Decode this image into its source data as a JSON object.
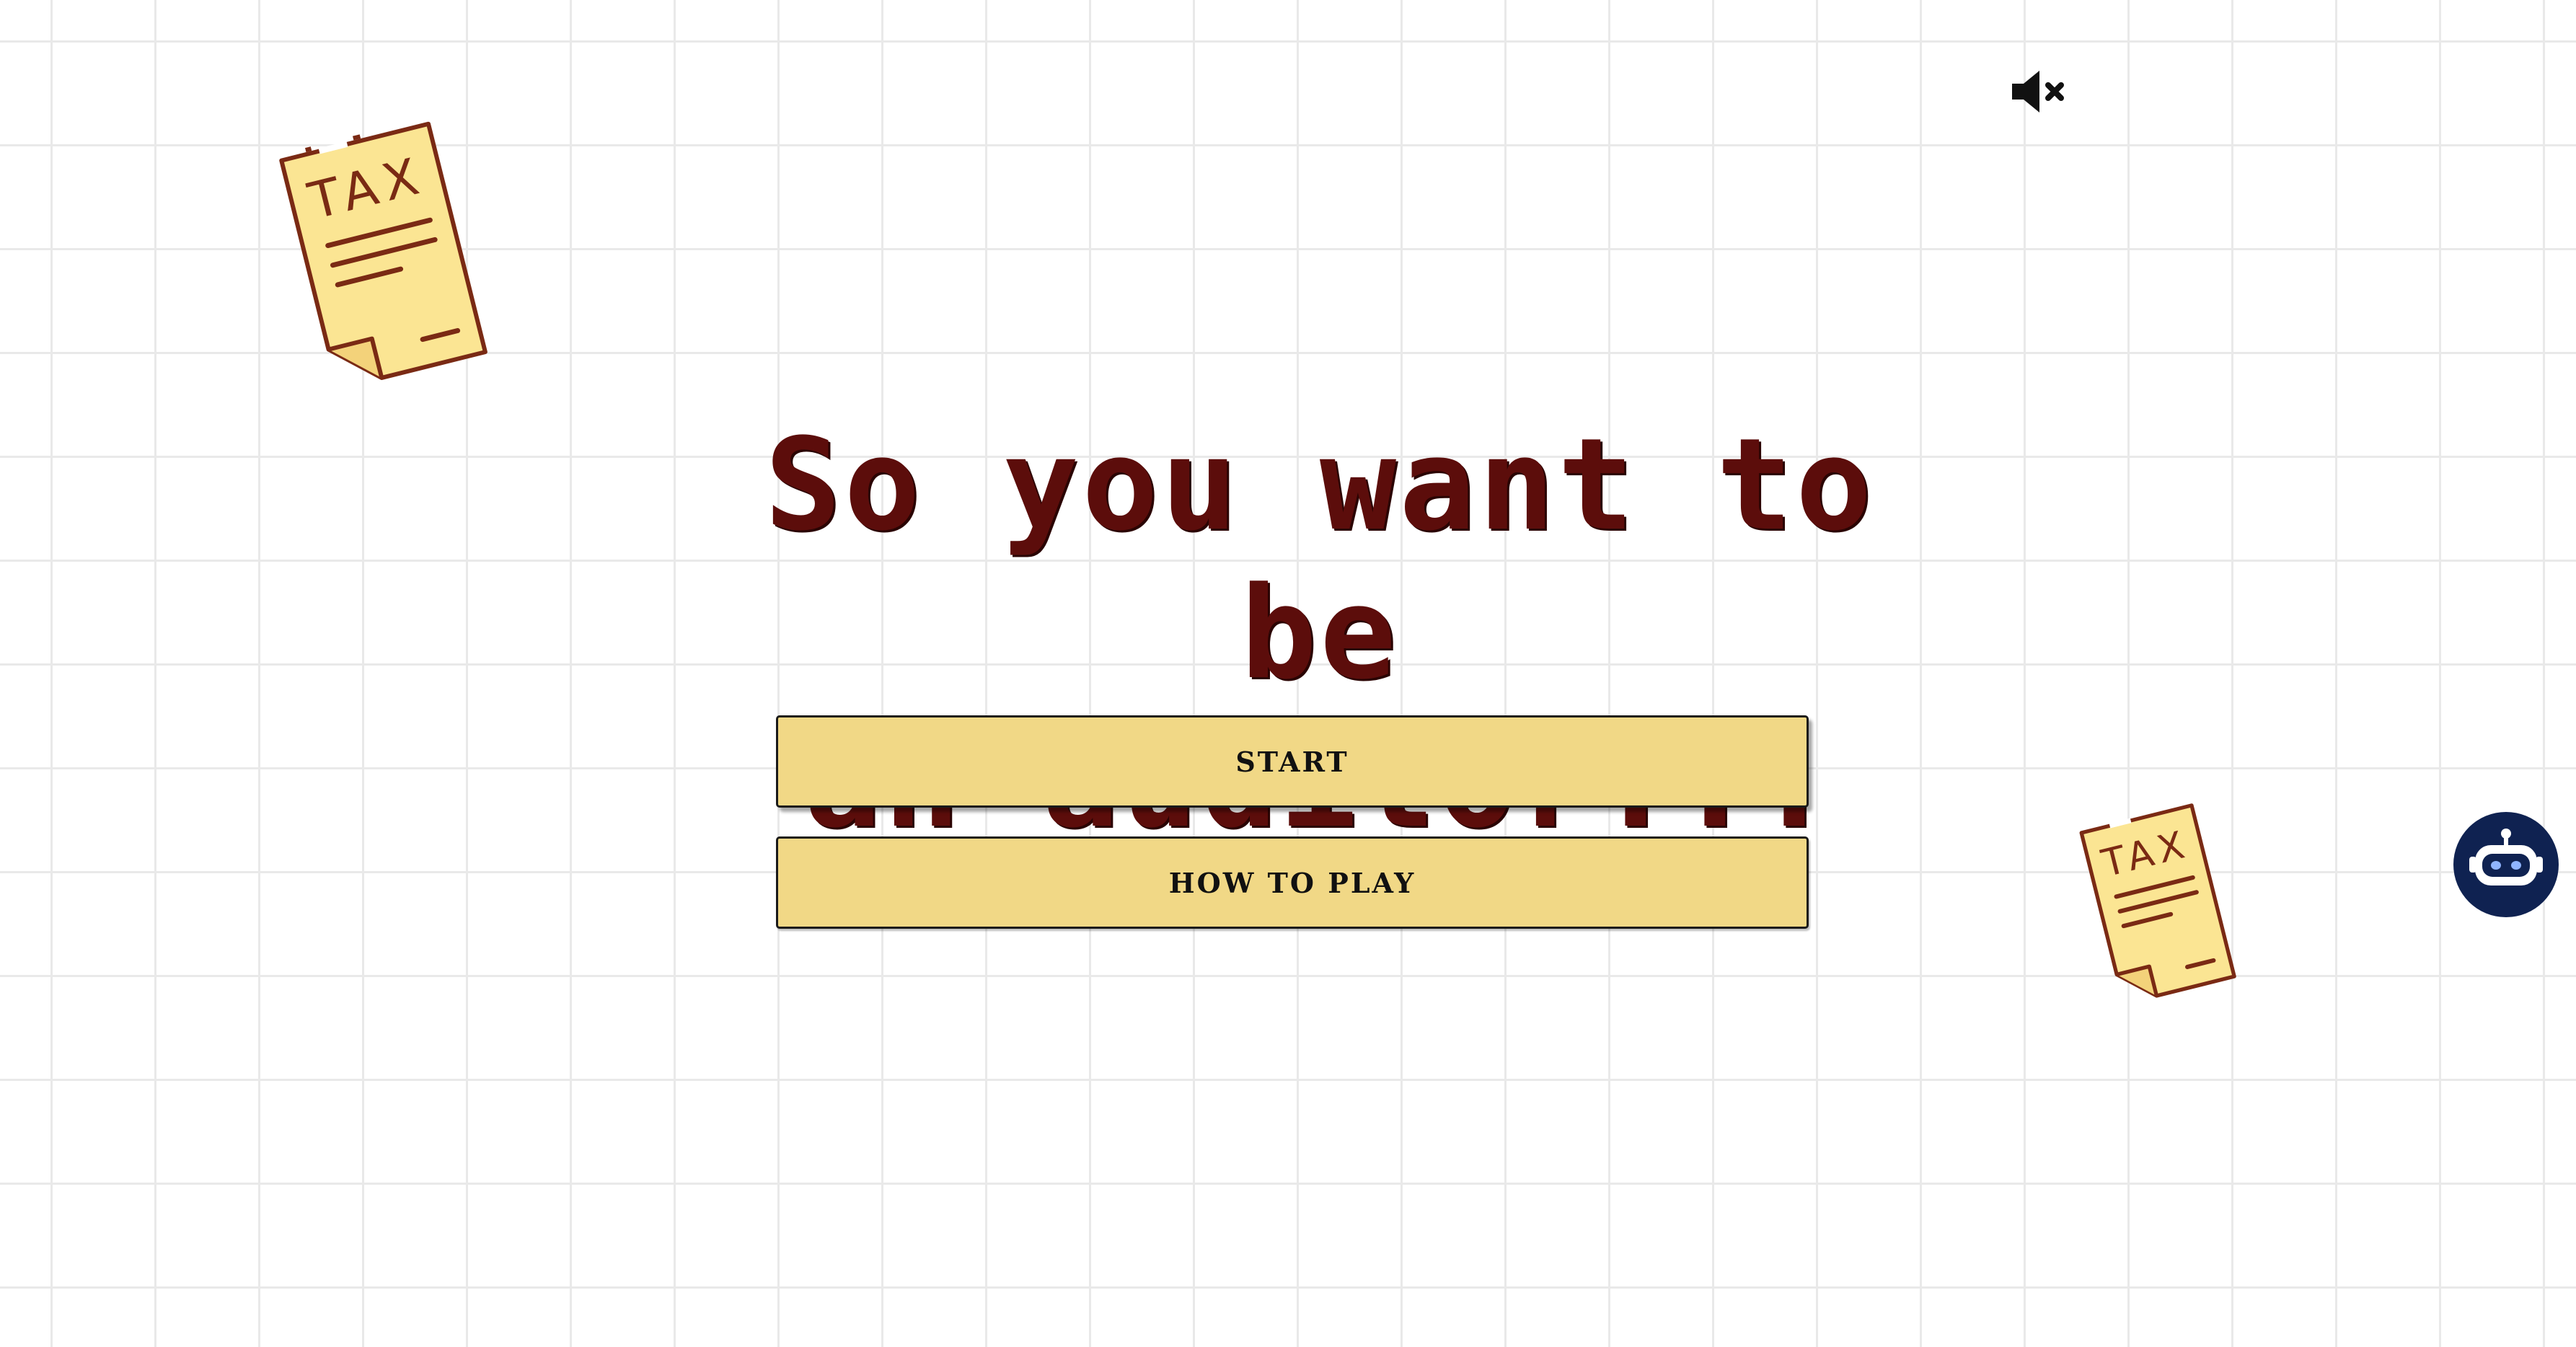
{
  "audio": {
    "icon": "speaker-muted-icon"
  },
  "decorations": {
    "document_label_left": "TAX",
    "document_label_right": "TAX",
    "document_icon": "tax-document-icon"
  },
  "title": {
    "text": "So you want to be\nan auditor..."
  },
  "menu": {
    "start_label": "START",
    "how_to_play_label": "HOW TO PLAY"
  },
  "chatbot": {
    "icon": "robot-icon"
  },
  "colors": {
    "title": "#5c0d0b",
    "button_fill": "#f1d886",
    "document_fill": "#fbe593",
    "document_stroke": "#7a2a14",
    "chatbot_bg": "#0f2251",
    "grid_line": "#e9e9e9"
  }
}
